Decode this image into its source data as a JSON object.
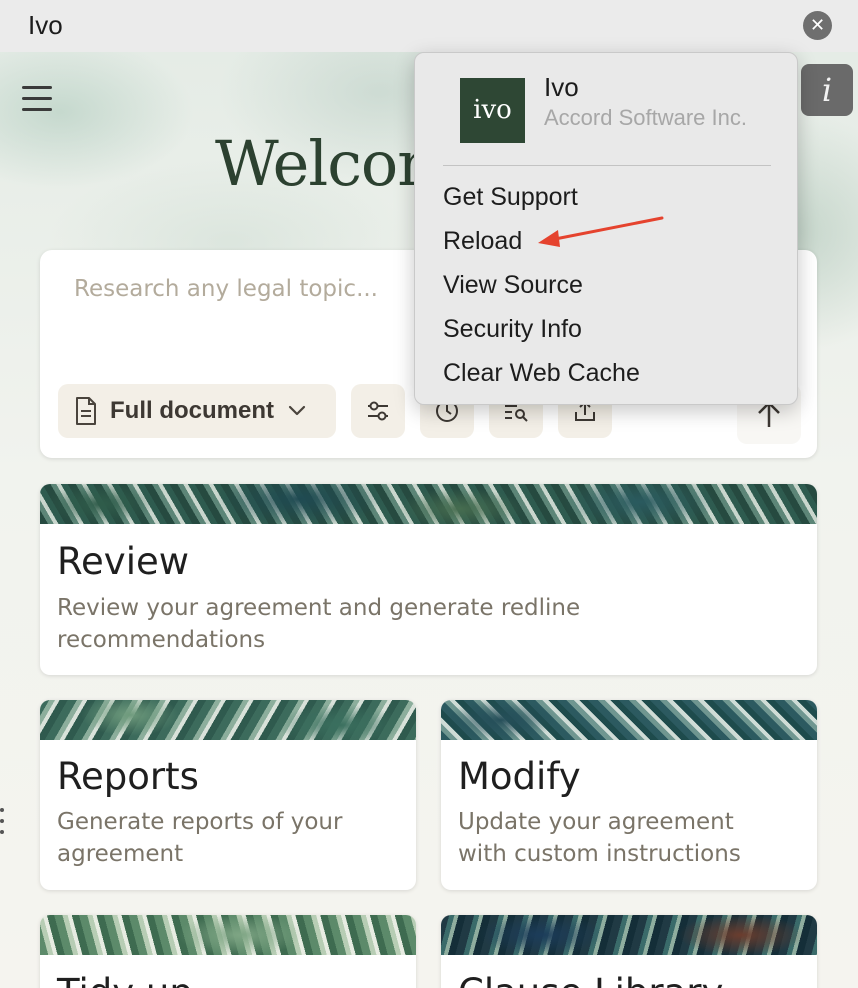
{
  "window": {
    "title": "Ivo",
    "close_glyph": "✕"
  },
  "header": {
    "menu_icon": "hamburger-icon",
    "heading": "Welcome",
    "info_glyph": "i"
  },
  "search": {
    "placeholder": "Research any legal topic...",
    "scope_label": "Full document",
    "tools": [
      "filter-sliders-icon",
      "history-clock-icon",
      "search-list-icon",
      "upload-icon"
    ],
    "submit_icon": "send-arrow-icon"
  },
  "cards": [
    {
      "title": "Review",
      "description": [
        "Review your agreement and generate redline",
        "recommendations"
      ]
    },
    {
      "title": "Reports",
      "description": [
        "Generate reports of your",
        "agreement"
      ]
    },
    {
      "title": "Modify",
      "description": [
        "Update your agreement",
        "with custom instructions"
      ]
    },
    {
      "title": "Tidy up",
      "description": []
    },
    {
      "title": "Clause Library",
      "description": []
    }
  ],
  "popup": {
    "logo_text": "ivo",
    "app_name": "Ivo",
    "company": "Accord Software Inc.",
    "menu_items": [
      "Get Support",
      "Reload",
      "View Source",
      "Security Info",
      "Clear Web Cache"
    ],
    "highlighted_item": "Reload",
    "arrow_color": "#e5432e"
  },
  "colors": {
    "accent": "#2c4130",
    "logo_bg": "#2e4734",
    "chip_bg": "#f3efe7"
  }
}
